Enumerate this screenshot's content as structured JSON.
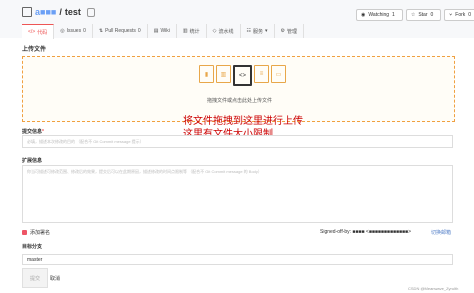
{
  "repo": {
    "owner": "a■■■",
    "sep": "/",
    "name": "test"
  },
  "actions": [
    {
      "icon": "eye",
      "label": "Watching",
      "count": "1"
    },
    {
      "icon": "star",
      "label": "Star",
      "count": "0"
    },
    {
      "icon": "fork",
      "label": "Fork",
      "count": "0"
    }
  ],
  "tabs": [
    "代码",
    "Issues",
    "Pull Requests",
    "Wiki",
    "统计",
    "流水线",
    "服务",
    "管理"
  ],
  "tab_counts": [
    "",
    "0",
    "0",
    "",
    "",
    "",
    "",
    ""
  ],
  "page_title": "上传文件",
  "drop_hint": "拖拽文件或点击此处上传文件",
  "note_line1": "将文件拖拽到这里进行上传",
  "note_line2": "这里有文件大小限制",
  "commit_label": "提交信息",
  "commit_required": "*",
  "commit_placeholder": "必填，描述本次修改的目的  （配合不 Git Commit message 提示）",
  "ext_label": "扩展信息",
  "ext_placeholder": "你当可描述可修改范围、修改后的效果，提交后可以在此期原因，描述修改的时间点限制等  （配合不 Git Commit message 的 Body）",
  "add_sign": "添加署名",
  "signed_off": "Signed-off-by: ■■■■ <■■■■■■■■■■■■■>",
  "switch_label": "切换邮箱",
  "target_label": "目标分支",
  "branch": "master",
  "submit_label": "提交",
  "cancel_label": "取消",
  "watermark": "CSDN @Meanwave_Zyrulth"
}
